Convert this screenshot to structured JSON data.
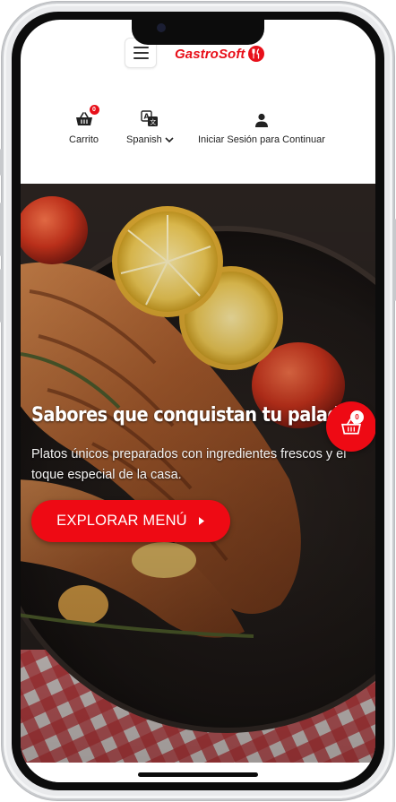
{
  "brand": {
    "name": "GastroSoft",
    "logo_icon": "fork-knife-icon"
  },
  "header": {
    "menu_icon": "hamburger-icon",
    "cart": {
      "label": "Carrito",
      "count": "0",
      "icon": "basket-icon"
    },
    "language": {
      "label": "Spanish",
      "icon": "translate-icon"
    },
    "login": {
      "label": "Iniciar Sesión para Continuar",
      "icon": "user-icon"
    }
  },
  "hero": {
    "title": "Sabores que conquistan tu paladar",
    "subtitle": "Platos únicos preparados con ingredientes frescos y el toque especial de la casa.",
    "cta_label": "EXPLORAR MENÚ",
    "cta_icon": "caret-right-icon"
  },
  "floating_cart": {
    "count": "0",
    "icon": "basket-icon"
  },
  "colors": {
    "accent": "#ee0a14",
    "brand": "#e8101a"
  }
}
